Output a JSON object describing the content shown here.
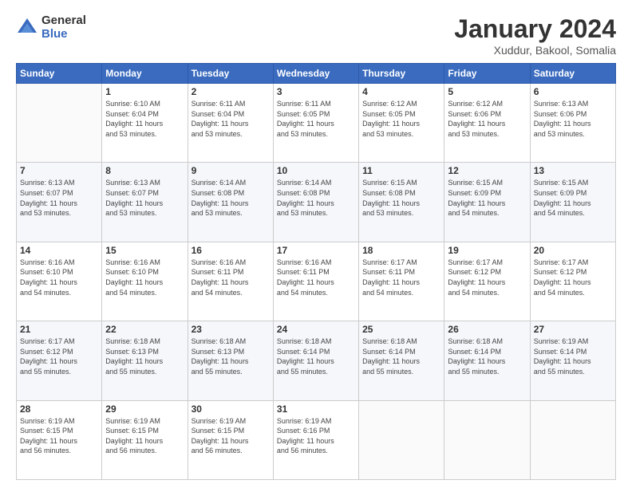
{
  "header": {
    "logo_general": "General",
    "logo_blue": "Blue",
    "title": "January 2024",
    "subtitle": "Xuddur, Bakool, Somalia"
  },
  "columns": [
    "Sunday",
    "Monday",
    "Tuesday",
    "Wednesday",
    "Thursday",
    "Friday",
    "Saturday"
  ],
  "weeks": [
    [
      {
        "day": "",
        "info": ""
      },
      {
        "day": "1",
        "info": "Sunrise: 6:10 AM\nSunset: 6:04 PM\nDaylight: 11 hours\nand 53 minutes."
      },
      {
        "day": "2",
        "info": "Sunrise: 6:11 AM\nSunset: 6:04 PM\nDaylight: 11 hours\nand 53 minutes."
      },
      {
        "day": "3",
        "info": "Sunrise: 6:11 AM\nSunset: 6:05 PM\nDaylight: 11 hours\nand 53 minutes."
      },
      {
        "day": "4",
        "info": "Sunrise: 6:12 AM\nSunset: 6:05 PM\nDaylight: 11 hours\nand 53 minutes."
      },
      {
        "day": "5",
        "info": "Sunrise: 6:12 AM\nSunset: 6:06 PM\nDaylight: 11 hours\nand 53 minutes."
      },
      {
        "day": "6",
        "info": "Sunrise: 6:13 AM\nSunset: 6:06 PM\nDaylight: 11 hours\nand 53 minutes."
      }
    ],
    [
      {
        "day": "7",
        "info": "Sunrise: 6:13 AM\nSunset: 6:07 PM\nDaylight: 11 hours\nand 53 minutes."
      },
      {
        "day": "8",
        "info": "Sunrise: 6:13 AM\nSunset: 6:07 PM\nDaylight: 11 hours\nand 53 minutes."
      },
      {
        "day": "9",
        "info": "Sunrise: 6:14 AM\nSunset: 6:08 PM\nDaylight: 11 hours\nand 53 minutes."
      },
      {
        "day": "10",
        "info": "Sunrise: 6:14 AM\nSunset: 6:08 PM\nDaylight: 11 hours\nand 53 minutes."
      },
      {
        "day": "11",
        "info": "Sunrise: 6:15 AM\nSunset: 6:08 PM\nDaylight: 11 hours\nand 53 minutes."
      },
      {
        "day": "12",
        "info": "Sunrise: 6:15 AM\nSunset: 6:09 PM\nDaylight: 11 hours\nand 54 minutes."
      },
      {
        "day": "13",
        "info": "Sunrise: 6:15 AM\nSunset: 6:09 PM\nDaylight: 11 hours\nand 54 minutes."
      }
    ],
    [
      {
        "day": "14",
        "info": "Sunrise: 6:16 AM\nSunset: 6:10 PM\nDaylight: 11 hours\nand 54 minutes."
      },
      {
        "day": "15",
        "info": "Sunrise: 6:16 AM\nSunset: 6:10 PM\nDaylight: 11 hours\nand 54 minutes."
      },
      {
        "day": "16",
        "info": "Sunrise: 6:16 AM\nSunset: 6:11 PM\nDaylight: 11 hours\nand 54 minutes."
      },
      {
        "day": "17",
        "info": "Sunrise: 6:16 AM\nSunset: 6:11 PM\nDaylight: 11 hours\nand 54 minutes."
      },
      {
        "day": "18",
        "info": "Sunrise: 6:17 AM\nSunset: 6:11 PM\nDaylight: 11 hours\nand 54 minutes."
      },
      {
        "day": "19",
        "info": "Sunrise: 6:17 AM\nSunset: 6:12 PM\nDaylight: 11 hours\nand 54 minutes."
      },
      {
        "day": "20",
        "info": "Sunrise: 6:17 AM\nSunset: 6:12 PM\nDaylight: 11 hours\nand 54 minutes."
      }
    ],
    [
      {
        "day": "21",
        "info": "Sunrise: 6:17 AM\nSunset: 6:12 PM\nDaylight: 11 hours\nand 55 minutes."
      },
      {
        "day": "22",
        "info": "Sunrise: 6:18 AM\nSunset: 6:13 PM\nDaylight: 11 hours\nand 55 minutes."
      },
      {
        "day": "23",
        "info": "Sunrise: 6:18 AM\nSunset: 6:13 PM\nDaylight: 11 hours\nand 55 minutes."
      },
      {
        "day": "24",
        "info": "Sunrise: 6:18 AM\nSunset: 6:14 PM\nDaylight: 11 hours\nand 55 minutes."
      },
      {
        "day": "25",
        "info": "Sunrise: 6:18 AM\nSunset: 6:14 PM\nDaylight: 11 hours\nand 55 minutes."
      },
      {
        "day": "26",
        "info": "Sunrise: 6:18 AM\nSunset: 6:14 PM\nDaylight: 11 hours\nand 55 minutes."
      },
      {
        "day": "27",
        "info": "Sunrise: 6:19 AM\nSunset: 6:14 PM\nDaylight: 11 hours\nand 55 minutes."
      }
    ],
    [
      {
        "day": "28",
        "info": "Sunrise: 6:19 AM\nSunset: 6:15 PM\nDaylight: 11 hours\nand 56 minutes."
      },
      {
        "day": "29",
        "info": "Sunrise: 6:19 AM\nSunset: 6:15 PM\nDaylight: 11 hours\nand 56 minutes."
      },
      {
        "day": "30",
        "info": "Sunrise: 6:19 AM\nSunset: 6:15 PM\nDaylight: 11 hours\nand 56 minutes."
      },
      {
        "day": "31",
        "info": "Sunrise: 6:19 AM\nSunset: 6:16 PM\nDaylight: 11 hours\nand 56 minutes."
      },
      {
        "day": "",
        "info": ""
      },
      {
        "day": "",
        "info": ""
      },
      {
        "day": "",
        "info": ""
      }
    ]
  ]
}
